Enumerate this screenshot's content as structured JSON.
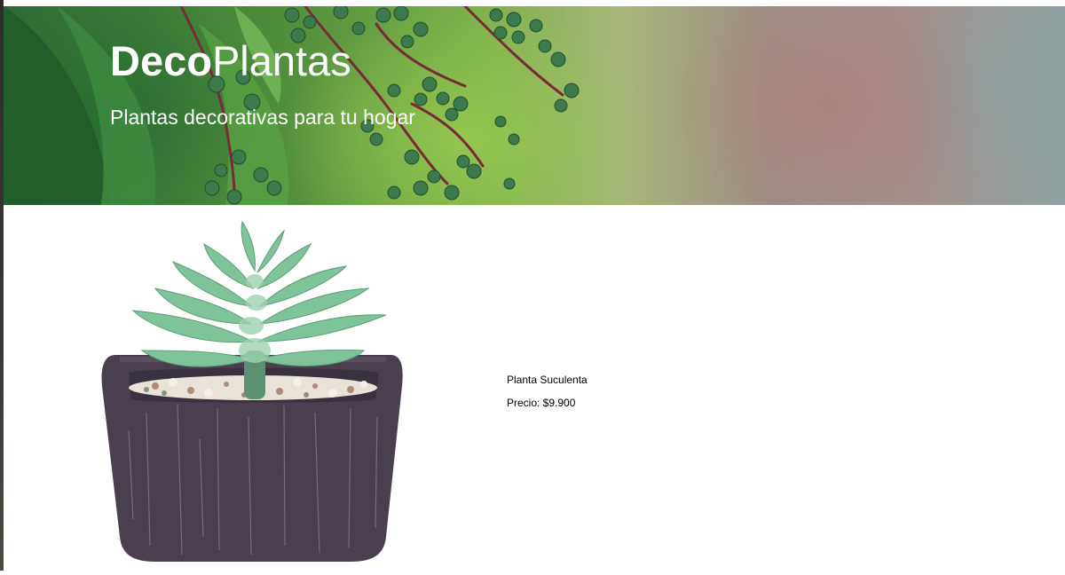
{
  "header": {
    "title_bold": "Deco",
    "title_regular": "Plantas",
    "subtitle": "Plantas decorativas para tu hogar"
  },
  "product": {
    "name": "Planta Suculenta",
    "price": "Precio: $9.900"
  },
  "colors": {
    "hero_text": "#ffffff",
    "pot": "#4a3f4f",
    "leaf": "#7ec39a"
  }
}
